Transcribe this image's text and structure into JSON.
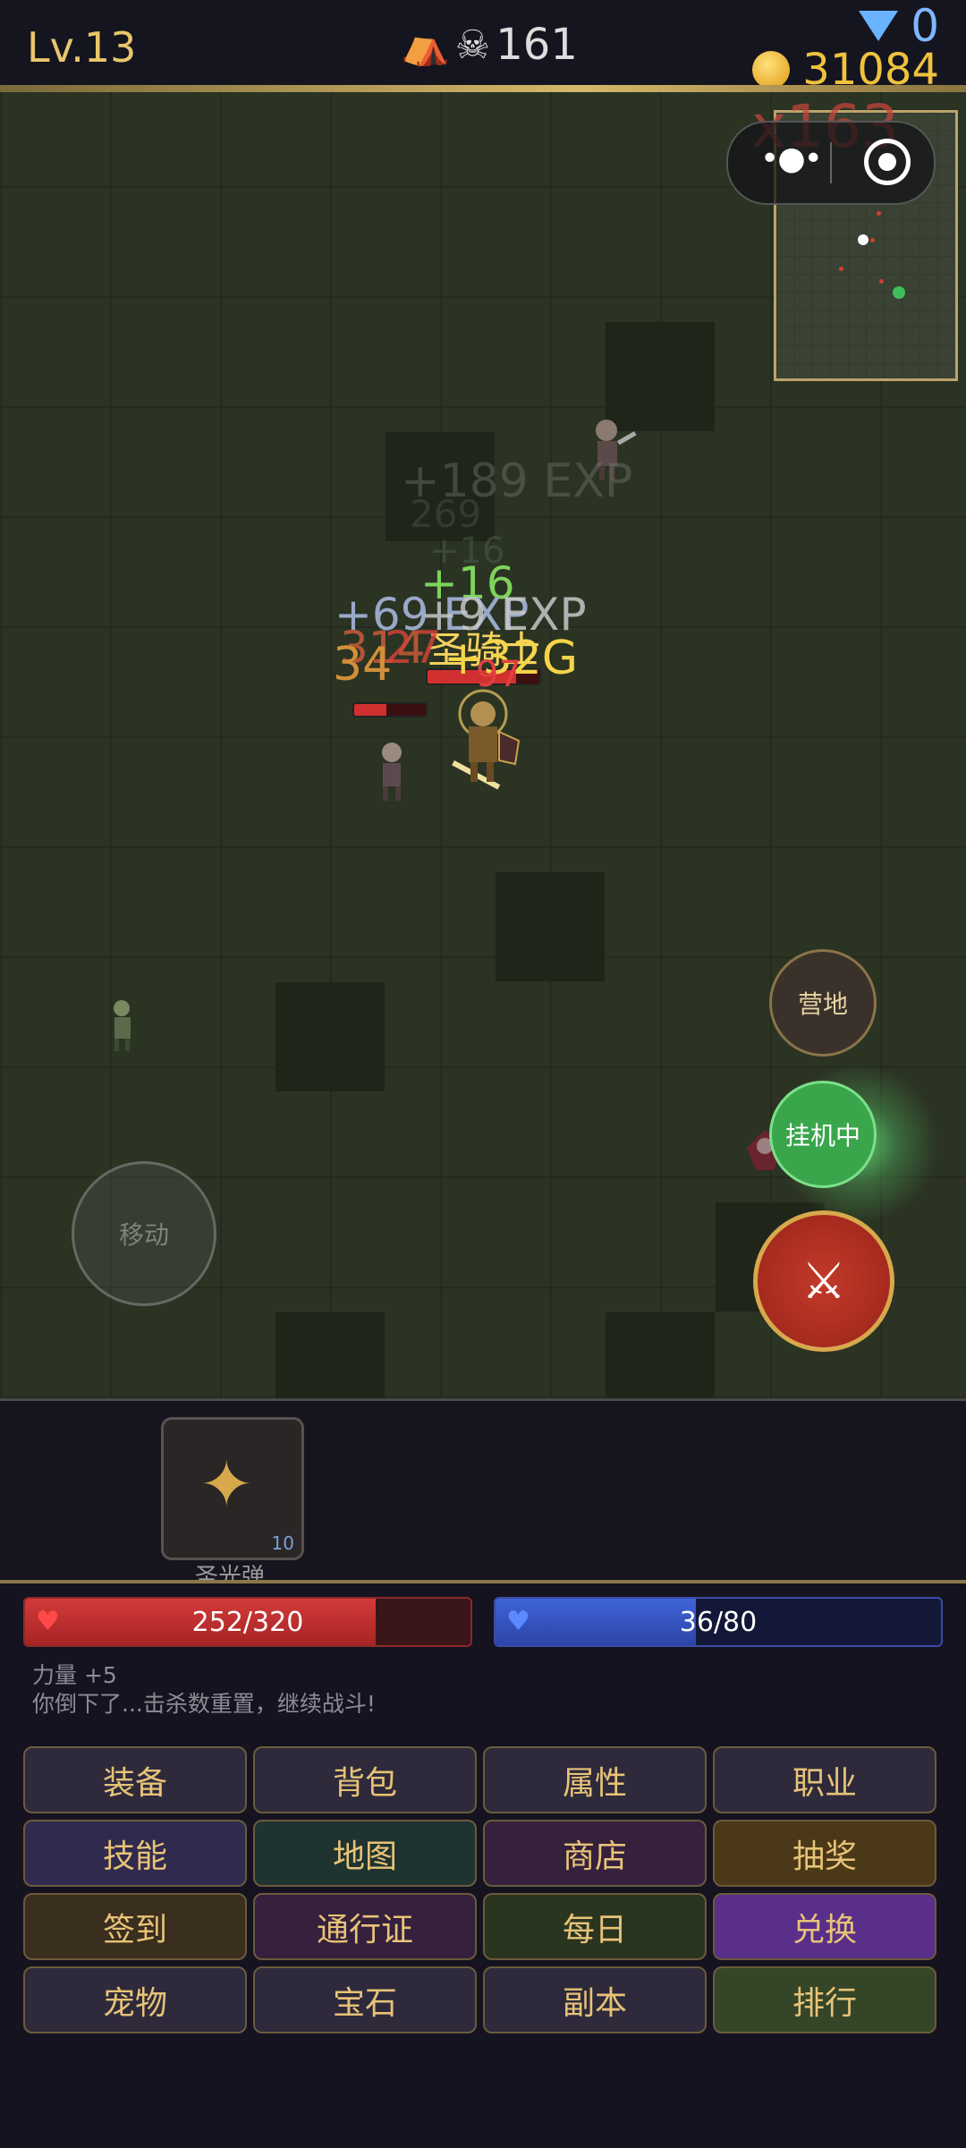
{
  "hud": {
    "level": "Lv.13",
    "kills_icon": "tent-icon",
    "kills": "161",
    "gems": "0",
    "gold": "31084"
  },
  "field": {
    "combo": "x163",
    "floating_texts": [
      {
        "text": "+189 EXP",
        "color": "#7f8a80"
      },
      {
        "text": "269",
        "color": "#5a6055"
      },
      {
        "text": "+16",
        "color": "#5a6a55"
      },
      {
        "text": "+16",
        "color": "#7ed35a"
      },
      {
        "text": "+69 EXP",
        "color": "#9aa8c8"
      },
      {
        "text": "+9 EXP",
        "color": "#c8c8c8"
      },
      {
        "text": "圣骑士",
        "color": "#f4d35e"
      },
      {
        "text": "314",
        "color": "#c85c3a"
      },
      {
        "text": "27",
        "color": "#d9443a"
      },
      {
        "text": "34",
        "color": "#d2903a"
      },
      {
        "text": "+32G",
        "color": "#f6d44a"
      },
      {
        "text": "97",
        "color": "#e04040"
      }
    ],
    "camp_label": "营地",
    "auto_label": "挂机中",
    "move_label": "移动"
  },
  "skill": {
    "name": "圣光弹",
    "count": "10"
  },
  "status": {
    "hp_text": "252/320",
    "hp_fraction": 0.7875,
    "mp_text": "36/80",
    "mp_fraction": 0.45
  },
  "log": [
    "力量 +5",
    "你倒下了...击杀数重置，继续战斗!"
  ],
  "menu": [
    {
      "label": "装备",
      "bg": "#2e2a3c",
      "color": "#e7c377"
    },
    {
      "label": "背包",
      "bg": "#2e2a3c",
      "color": "#e7c377"
    },
    {
      "label": "属性",
      "bg": "#2e2a3c",
      "color": "#e7c377"
    },
    {
      "label": "职业",
      "bg": "#2e2a3c",
      "color": "#e7c377"
    },
    {
      "label": "技能",
      "bg": "#302a4e",
      "color": "#e7c377"
    },
    {
      "label": "地图",
      "bg": "#1f3330",
      "color": "#e7c377"
    },
    {
      "label": "商店",
      "bg": "#35203e",
      "color": "#e7c377"
    },
    {
      "label": "抽奖",
      "bg": "#4a3818",
      "color": "#e7c377"
    },
    {
      "label": "签到",
      "bg": "#3a2e1e",
      "color": "#e7c377"
    },
    {
      "label": "通行证",
      "bg": "#35203e",
      "color": "#e7c377"
    },
    {
      "label": "每日",
      "bg": "#2a3520",
      "color": "#e7c377"
    },
    {
      "label": "兑换",
      "bg": "#5a2f8a",
      "color": "#e7c377"
    },
    {
      "label": "宠物",
      "bg": "#2e2a3c",
      "color": "#e7c377"
    },
    {
      "label": "宝石",
      "bg": "#2e2a3c",
      "color": "#e7c377"
    },
    {
      "label": "副本",
      "bg": "#2e2a3c",
      "color": "#e7c377"
    },
    {
      "label": "排行",
      "bg": "#354528",
      "color": "#e7c377"
    }
  ]
}
